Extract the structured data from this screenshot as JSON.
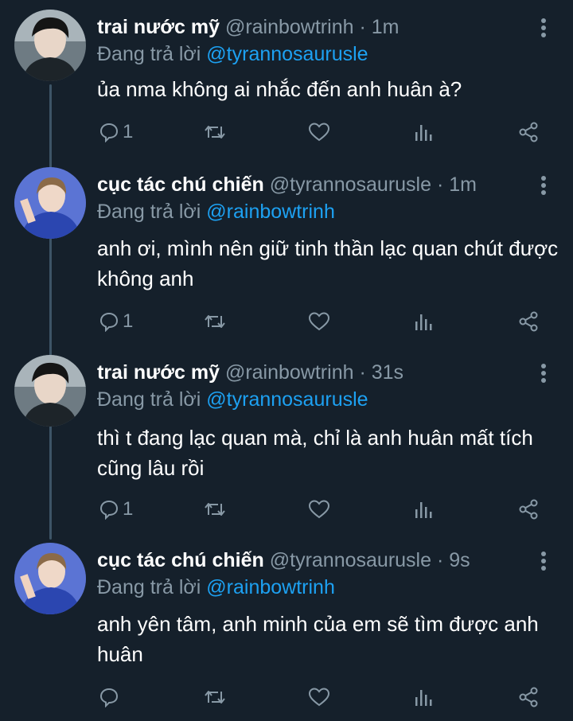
{
  "colors": {
    "background": "#15202b",
    "secondary_text": "#8899a6",
    "mention": "#1da1f2",
    "thread_line": "#3d5466"
  },
  "tweets": [
    {
      "display_name": "trai nước mỹ",
      "handle": "@rainbowtrinh",
      "separator": "·",
      "time": "1m",
      "reply_prefix": "Đang trả lời",
      "reply_to": "@tyrannosaurusle",
      "text": "ủa nma không ai nhắc đến anh huân à?",
      "reply_count": "1",
      "avatar_icon": "avatar-dark-hair-icon"
    },
    {
      "display_name": "cục tác chú chiến",
      "handle": "@tyrannosaurusle",
      "separator": "·",
      "time": "1m",
      "reply_prefix": "Đang trả lời",
      "reply_to": "@rainbowtrinh",
      "text": "anh ơi, mình nên giữ tinh thần lạc quan chút được không anh",
      "reply_count": "1",
      "avatar_icon": "avatar-blue-icon"
    },
    {
      "display_name": "trai nước mỹ",
      "handle": "@rainbowtrinh",
      "separator": "·",
      "time": "31s",
      "reply_prefix": "Đang trả lời",
      "reply_to": "@tyrannosaurusle",
      "text": "thì t đang lạc quan mà, chỉ là anh huân mất tích cũng lâu rồi",
      "reply_count": "1",
      "avatar_icon": "avatar-dark-hair-icon"
    },
    {
      "display_name": "cục tác chú chiến",
      "handle": "@tyrannosaurusle",
      "separator": "·",
      "time": "9s",
      "reply_prefix": "Đang trả lời",
      "reply_to": "@rainbowtrinh",
      "text": "anh yên tâm, anh minh của em sẽ tìm được anh huân",
      "reply_count": "",
      "avatar_icon": "avatar-blue-icon"
    }
  ],
  "action_icons": [
    "reply-icon",
    "retweet-icon",
    "like-icon",
    "analytics-icon",
    "share-icon"
  ]
}
